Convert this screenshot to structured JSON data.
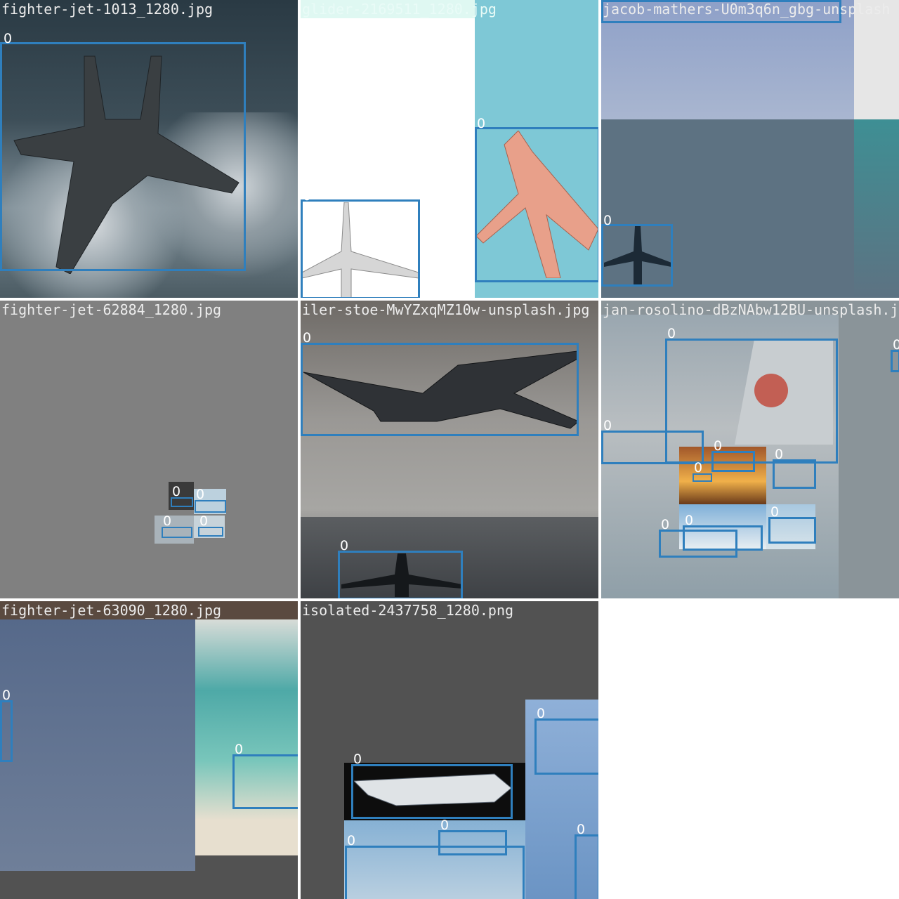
{
  "grid": {
    "tiles": [
      {
        "title": "fighter-jet-1013_1280.jpg",
        "class_label": "0",
        "subject": "fighter-jet-icon"
      },
      {
        "title": "glider-2169511_1280.jpg",
        "class_label": "0",
        "subject": "airliner-icon"
      },
      {
        "title": "jacob-mathers-U0m3q6n_gbg-unsplash",
        "class_label": "0",
        "subject": "airliner-icon"
      },
      {
        "title": "fighter-jet-62884_1280.jpg",
        "class_label": "0",
        "subject": "airliner-icon"
      },
      {
        "title": "iler-stoe-MwYZxqMZ10w-unsplash.jpg",
        "class_label": "0",
        "subject": "airliner-icon"
      },
      {
        "title": "jan-rosolino-dBzNAbw12BU-unsplash.jp",
        "class_label": "0",
        "subject": "airliner-icon"
      },
      {
        "title": "fighter-jet-63090_1280.jpg",
        "class_label": "0",
        "subject": "airliner-icon"
      },
      {
        "title": "isolated-2437758_1280.png",
        "class_label": "0",
        "subject": "airliner-icon"
      }
    ],
    "box_color": "#2f7fbd",
    "label_color": "#ffffff"
  }
}
